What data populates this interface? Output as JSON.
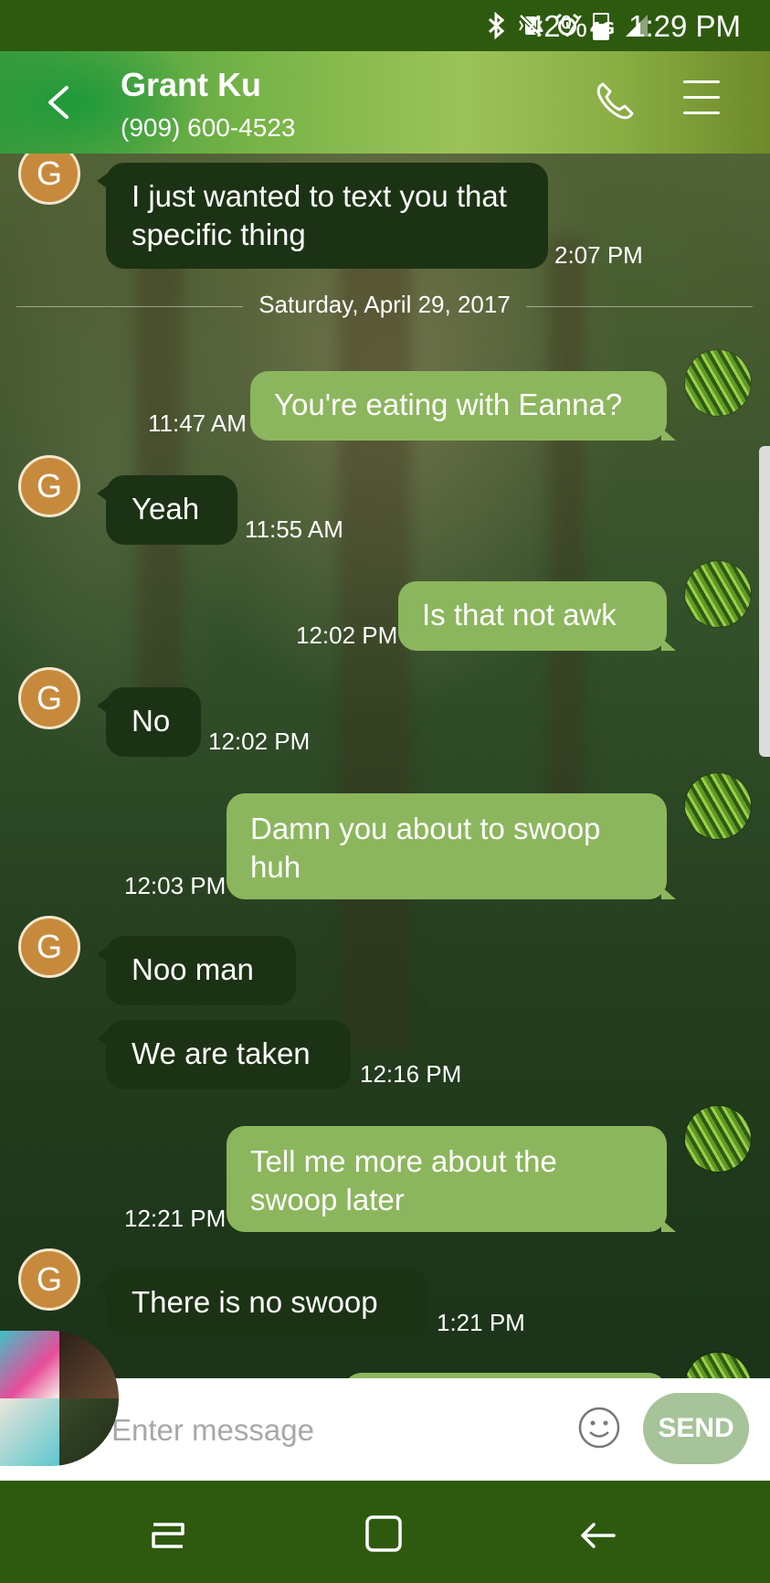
{
  "status_bar": {
    "icons": [
      "bluetooth-icon",
      "vibrate-mute-icon",
      "alarm-icon",
      "lte-icon",
      "signal-icon",
      "battery-icon"
    ],
    "network": "4G",
    "battery_percent": "42%",
    "time": "1:29 PM"
  },
  "header": {
    "contact_name": "Grant Ku",
    "contact_phone": "(909) 600-4523"
  },
  "contact_initial": "G",
  "messages": [
    {
      "dir": "in",
      "text": "I just wanted to text you that specific thing",
      "time": "2:07 PM"
    },
    {
      "dir": "out",
      "text": "You're eating with Eanna?",
      "time": "11:47 AM"
    },
    {
      "dir": "in",
      "text": "Yeah",
      "time": "11:55 AM"
    },
    {
      "dir": "out",
      "text": "Is that not awk",
      "time": "12:02 PM"
    },
    {
      "dir": "in",
      "text": "No",
      "time": "12:02 PM"
    },
    {
      "dir": "out",
      "text": "Damn you about to swoop huh",
      "time": "12:03 PM"
    },
    {
      "dir": "in",
      "text": "Noo man",
      "time": ""
    },
    {
      "dir": "in",
      "text": "We are taken",
      "time": "12:16 PM"
    },
    {
      "dir": "out",
      "text": "Tell me more about the swoop later",
      "time": "12:21 PM"
    },
    {
      "dir": "in",
      "text": "There is no swoop",
      "time": "1:21 PM"
    }
  ],
  "date_divider": "Saturday, April 29, 2017",
  "composer": {
    "placeholder": "Enter message",
    "send_label": "SEND"
  },
  "colors": {
    "status_bar": "#2e5a0f",
    "incoming_bubble": "#1c3214",
    "outgoing_bubble": "#8cb65d",
    "send_button": "#a6c39a",
    "avatar_g": "#c78a3c"
  }
}
